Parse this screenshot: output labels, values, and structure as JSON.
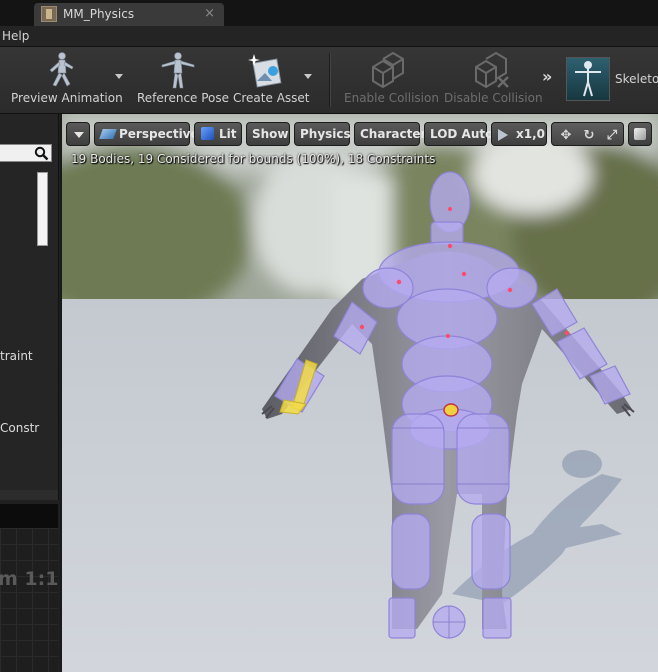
{
  "tab": {
    "title": "MM_Physics",
    "close": "×"
  },
  "menu": {
    "help": "Help"
  },
  "toolbar": {
    "preview_animation": "Preview Animation",
    "reference_pose": "Reference Pose",
    "create_asset": "Create Asset",
    "enable_collision": "Enable Collision",
    "disable_collision": "Disable Collision",
    "more": "»",
    "skeleton": "Skeleton"
  },
  "left_panel": {
    "row1": "traint",
    "row2": "Constr",
    "zoom": "m 1:1"
  },
  "viewport": {
    "perspective": "Perspective",
    "lit": "Lit",
    "show": "Show",
    "physics": "Physics",
    "character": "Character",
    "lod": "LOD Auto",
    "speed": "x1,0",
    "stats": "19 Bodies, 19 Considered for bounds (100%), 18 Constraints"
  },
  "colors": {
    "body_overlay": "#b5aaf0",
    "body_outline": "#8f84d8",
    "selected_body": "#f2dc48",
    "floor": "#c9ced4"
  }
}
